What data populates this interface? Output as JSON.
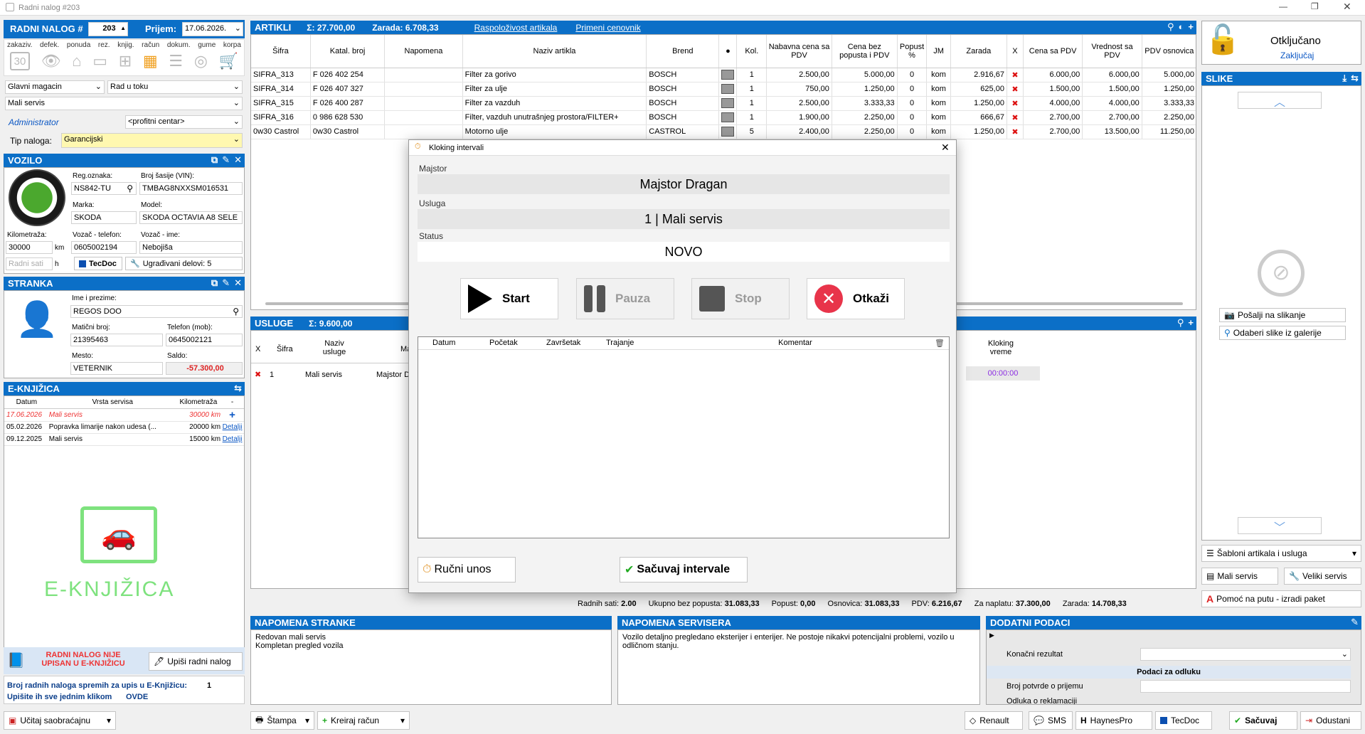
{
  "window": {
    "title": "Radni nalog #203"
  },
  "header": {
    "order_label": "RADNI NALOG #",
    "order_number": "203",
    "received_label": "Prijem:",
    "received_date": "17.06.2026.",
    "toolbar": [
      "zakaziv.",
      "defek.",
      "ponuda",
      "rez.",
      "knjig.",
      "račun",
      "dokum.",
      "gume",
      "korpa"
    ],
    "calendar_day": "30",
    "warehouse": "Glavni magacin",
    "status": "Rad u toku",
    "service": "Mali servis",
    "user": "Administrator",
    "profit_center": "<profitni centar>",
    "order_type_label": "Tip naloga:",
    "order_type": "Garancijski"
  },
  "vehicle": {
    "title": "VOZILO",
    "reg_label": "Reg.oznaka:",
    "reg": "NS842-TU",
    "vin_label": "Broj šasije (VIN):",
    "vin": "TMBAG8NXXSM016531",
    "make_label": "Marka:",
    "make": "SKODA",
    "model_label": "Model:",
    "model": "SKODA OCTAVIA A8 SELE",
    "km_label": "Kilometraža:",
    "km": "30000",
    "km_unit": "km",
    "phone_label": "Vozač - telefon:",
    "phone": "0605002194",
    "driver_label": "Vozač - ime:",
    "driver": "Nebojiša",
    "hours_placeholder": "Radni sati",
    "hours_unit": "h",
    "tecdoc": "TecDoc",
    "parts": "Ugrađivani delovi: 5"
  },
  "client": {
    "title": "STRANKA",
    "name_label": "Ime i prezime:",
    "name": "REGOS DOO",
    "mb_label": "Matični broj:",
    "mb": "21395463",
    "tel_label": "Telefon (mob):",
    "tel": "0645002121",
    "city_label": "Mesto:",
    "city": "VETERNIK",
    "balance_label": "Saldo:",
    "balance": "-57.300,00"
  },
  "ebook": {
    "title": "E-KNJIŽICA",
    "cols": [
      "Datum",
      "Vrsta servisa",
      "Kilometraža",
      "-"
    ],
    "rows": [
      {
        "date": "17.06.2026",
        "type": "Mali servis",
        "km": "30000 km",
        "action": "+"
      },
      {
        "date": "05.02.2026",
        "type": "Popravka limarije nakon udesa (...",
        "km": "20000 km",
        "action": "Detalji"
      },
      {
        "date": "09.12.2025",
        "type": "Mali servis",
        "km": "15000 km",
        "action": "Detalji"
      }
    ],
    "logo_text": "E-KNJIŽICA",
    "warn": "RADNI NALOG NIJE UPISAN U E-KNJIŽICU",
    "write_btn": "Upiši radni nalog",
    "ready_label": "Broj radnih naloga spremih za upis u E-Knjižicu:",
    "ready_count": "1",
    "all_label": "Upišite ih sve jednim klikom",
    "all_link": "OVDE"
  },
  "articles": {
    "title": "ARTIKLI",
    "sum": "Σ: 27.700,00",
    "profit": "Zarada: 6.708,33",
    "link1": "Raspoloživost artikala",
    "link2": "Primeni cenovnik",
    "cols": [
      "Šifra",
      "Katal. broj",
      "Napomena",
      "Naziv artikla",
      "Brend",
      "●",
      "Kol.",
      "Nabavna cena sa PDV",
      "Cena bez popusta i PDV",
      "Popust %",
      "JM",
      "Zarada",
      "X",
      "Cena sa PDV",
      "Vrednost sa PDV",
      "PDV osnovica"
    ],
    "rows": [
      [
        "SIFRA_313",
        "F 026 402 254",
        "",
        "Filter za gorivo",
        "BOSCH",
        "",
        "1",
        "2.500,00",
        "5.000,00",
        "0",
        "kom",
        "2.916,67",
        "✖",
        "6.000,00",
        "6.000,00",
        "5.000,00"
      ],
      [
        "SIFRA_314",
        "F 026 407 327",
        "",
        "Filter za ulje",
        "BOSCH",
        "",
        "1",
        "750,00",
        "1.250,00",
        "0",
        "kom",
        "625,00",
        "✖",
        "1.500,00",
        "1.500,00",
        "1.250,00"
      ],
      [
        "SIFRA_315",
        "F 026 400 287",
        "",
        "Filter za vazduh",
        "BOSCH",
        "",
        "1",
        "2.500,00",
        "3.333,33",
        "0",
        "kom",
        "1.250,00",
        "✖",
        "4.000,00",
        "4.000,00",
        "3.333,33"
      ],
      [
        "SIFRA_316",
        "0 986 628 530",
        "",
        "Filter, vazduh unutrašnjeg prostora/FILTER+",
        "BOSCH",
        "",
        "1",
        "1.900,00",
        "2.250,00",
        "0",
        "kom",
        "666,67",
        "✖",
        "2.700,00",
        "2.700,00",
        "2.250,00"
      ],
      [
        "0w30 Castrol",
        "0w30 Castrol",
        "",
        "Motorno ulje",
        "CASTROL",
        "",
        "5",
        "2.400,00",
        "2.250,00",
        "0",
        "kom",
        "1.250,00",
        "✖",
        "2.700,00",
        "13.500,00",
        "11.250,00"
      ]
    ]
  },
  "services": {
    "title": "USLUGE",
    "sum": "Σ: 9.600,00",
    "cols": [
      "X",
      "Šifra",
      "Naziv usluge",
      "Ma"
    ],
    "row": {
      "x": "✖",
      "code": "1",
      "name": "Mali servis",
      "master": "Majstor D"
    },
    "clock_col": "Kloking vreme",
    "clock": "00:00:00"
  },
  "totals": {
    "hours_label": "Radnih sati:",
    "hours": "2.00",
    "nodisc_label": "Ukupno bez popusta:",
    "nodisc": "31.083,33",
    "disc_label": "Popust:",
    "disc": "0,00",
    "base_label": "Osnovica:",
    "base": "31.083,33",
    "vat_label": "PDV:",
    "vat": "6.216,67",
    "pay_label": "Za naplatu:",
    "pay": "37.300,00",
    "profit_label": "Zarada:",
    "profit": "14.708,33"
  },
  "notes": {
    "client_title": "NAPOMENA STRANKE",
    "client_text": "Redovan mali servis\nKompletan pregled vozila",
    "service_title": "NAPOMENA SERVISERA",
    "service_text": "Vozilo detaljno pregledano eksterijer i enterijer. Ne postoje nikakvi potencijalni problemi, vozilo u odličnom stanju.",
    "extra_title": "DODATNI PODACI",
    "final_label": "Konačni rezultat",
    "section": "Podaci za odluku",
    "confirm_label": "Broj potvrde o prijemu",
    "complaint_label": "Odluka o reklamaciji"
  },
  "right": {
    "unlocked": "Otključano",
    "lock_link": "Zaključaj",
    "images_title": "SLIKE",
    "send_btn": "Pošalji na slikanje",
    "gallery_btn": "Odaberi slike iz galerije",
    "templates": "Šabloni artikala i usluga",
    "small": "Mali servis",
    "big": "Veliki servis",
    "help": "Pomoć na putu - izradi paket"
  },
  "bottom": {
    "traffic": "Učitaj saobraćajnu",
    "print": "Štampa",
    "invoice": "Kreiraj račun",
    "renault": "Renault",
    "sms": "SMS",
    "haynes": "HaynesPro",
    "tecdoc": "TecDoc",
    "save": "Sačuvaj",
    "cancel": "Odustani"
  },
  "modal": {
    "title": "Kloking intervali",
    "master_label": "Majstor",
    "master": "Majstor Dragan",
    "service_label": "Usluga",
    "service": "1 | Mali servis",
    "status_label": "Status",
    "status": "NOVO",
    "start": "Start",
    "pause": "Pauza",
    "stop": "Stop",
    "cancel": "Otkaži",
    "cols": [
      "Datum",
      "Početak",
      "Završetak",
      "Trajanje",
      "Komentar"
    ],
    "manual": "Ručni unos",
    "save": "Sačuvaj intervale"
  }
}
